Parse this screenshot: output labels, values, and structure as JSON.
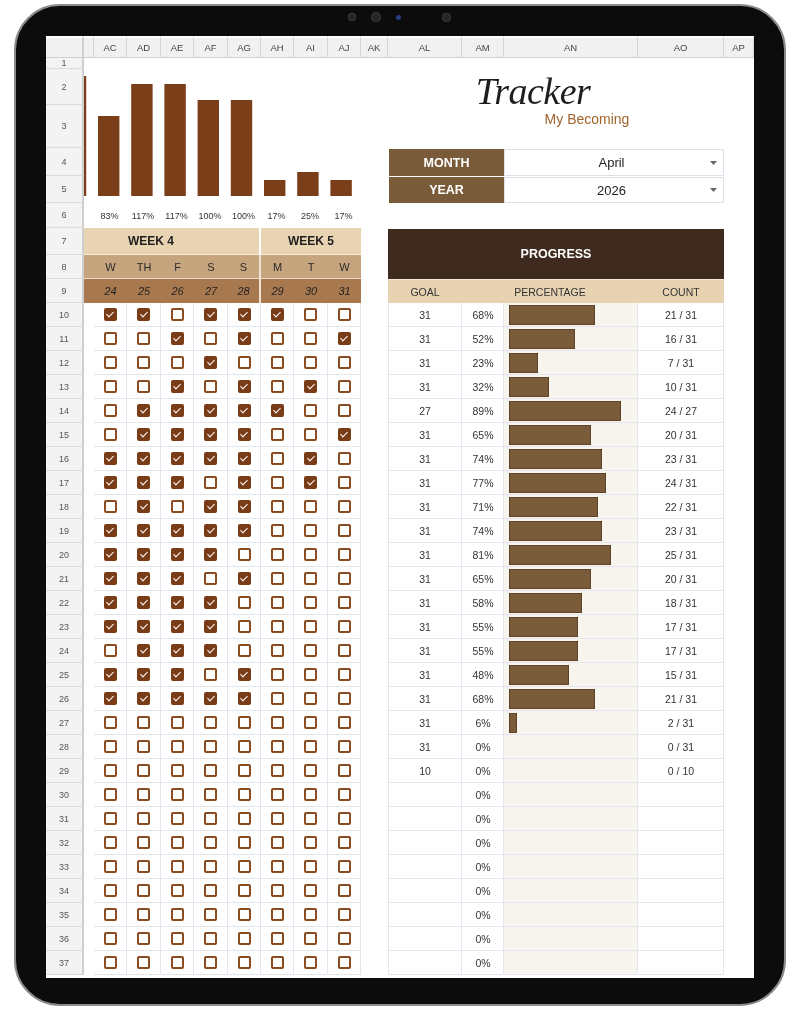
{
  "sheet": {
    "column_headers": [
      "AC",
      "AD",
      "AE",
      "AF",
      "AG",
      "AH",
      "AI",
      "AJ",
      "AK",
      "AL",
      "AM",
      "AN",
      "AO",
      "AP"
    ],
    "row_numbers": [
      "1",
      "2",
      "3",
      "4",
      "5",
      "6",
      "7",
      "8",
      "9",
      "10",
      "11",
      "12",
      "13",
      "14",
      "15",
      "16",
      "17",
      "18",
      "19",
      "20",
      "21",
      "22",
      "23",
      "24",
      "25",
      "26",
      "27",
      "28",
      "29",
      "30",
      "31",
      "32",
      "33",
      "34",
      "35",
      "36",
      "37"
    ]
  },
  "daily_percentages": [
    "83%",
    "117%",
    "117%",
    "100%",
    "100%",
    "17%",
    "25%",
    "17%"
  ],
  "logo": {
    "title": "Tracker",
    "subtitle": "My Becoming"
  },
  "selectors": [
    {
      "label": "MONTH",
      "value": "April"
    },
    {
      "label": "YEAR",
      "value": "2026"
    }
  ],
  "weeks": [
    {
      "label": "WEEK 4",
      "days": [
        {
          "day": "W",
          "date": "24"
        },
        {
          "day": "TH",
          "date": "25"
        },
        {
          "day": "F",
          "date": "26"
        },
        {
          "day": "S",
          "date": "27"
        },
        {
          "day": "S",
          "date": "28"
        }
      ]
    },
    {
      "label": "WEEK 5",
      "days": [
        {
          "day": "M",
          "date": "29"
        },
        {
          "day": "T",
          "date": "30"
        },
        {
          "day": "W",
          "date": "31"
        }
      ]
    }
  ],
  "habits": [
    {
      "checks": [
        {
          "checked": true
        },
        {
          "checked": true
        },
        {
          "checked": false
        },
        {
          "checked": true
        },
        {
          "checked": true
        },
        {
          "checked": true
        },
        {
          "checked": false
        },
        {
          "checked": false
        }
      ]
    },
    {
      "checks": [
        {
          "checked": false
        },
        {
          "checked": false
        },
        {
          "checked": true
        },
        {
          "checked": false
        },
        {
          "checked": true
        },
        {
          "checked": false
        },
        {
          "checked": false
        },
        {
          "checked": true
        }
      ]
    },
    {
      "checks": [
        {
          "checked": false
        },
        {
          "checked": false
        },
        {
          "checked": false
        },
        {
          "checked": true
        },
        {
          "checked": false
        },
        {
          "checked": false
        },
        {
          "checked": false
        },
        {
          "checked": false
        }
      ]
    },
    {
      "checks": [
        {
          "checked": false
        },
        {
          "checked": false
        },
        {
          "checked": true
        },
        {
          "checked": false
        },
        {
          "checked": true
        },
        {
          "checked": false
        },
        {
          "checked": true
        },
        {
          "checked": false
        }
      ]
    },
    {
      "checks": [
        {
          "checked": false
        },
        {
          "checked": true
        },
        {
          "checked": true
        },
        {
          "checked": true
        },
        {
          "checked": true
        },
        {
          "checked": true
        },
        {
          "checked": false
        },
        {
          "checked": false
        }
      ]
    },
    {
      "checks": [
        {
          "checked": false
        },
        {
          "checked": true
        },
        {
          "checked": true
        },
        {
          "checked": true
        },
        {
          "checked": true
        },
        {
          "checked": false
        },
        {
          "checked": false
        },
        {
          "checked": true
        }
      ]
    },
    {
      "checks": [
        {
          "checked": true
        },
        {
          "checked": true
        },
        {
          "checked": true
        },
        {
          "checked": true
        },
        {
          "checked": true
        },
        {
          "checked": false
        },
        {
          "checked": true
        },
        {
          "checked": false
        }
      ]
    },
    {
      "checks": [
        {
          "checked": true
        },
        {
          "checked": true
        },
        {
          "checked": true
        },
        {
          "checked": false
        },
        {
          "checked": true
        },
        {
          "checked": false
        },
        {
          "checked": true
        },
        {
          "checked": false
        }
      ]
    },
    {
      "checks": [
        {
          "checked": false
        },
        {
          "checked": true
        },
        {
          "checked": false
        },
        {
          "checked": true
        },
        {
          "checked": true
        },
        {
          "checked": false
        },
        {
          "checked": false
        },
        {
          "checked": false
        }
      ]
    },
    {
      "checks": [
        {
          "checked": true
        },
        {
          "checked": true
        },
        {
          "checked": true
        },
        {
          "checked": true
        },
        {
          "checked": true
        },
        {
          "checked": false
        },
        {
          "checked": false
        },
        {
          "checked": false
        }
      ]
    },
    {
      "checks": [
        {
          "checked": true
        },
        {
          "checked": true
        },
        {
          "checked": true
        },
        {
          "checked": true
        },
        {
          "checked": false
        },
        {
          "checked": false
        },
        {
          "checked": false
        },
        {
          "checked": false
        }
      ]
    },
    {
      "checks": [
        {
          "checked": true
        },
        {
          "checked": true
        },
        {
          "checked": true
        },
        {
          "checked": false
        },
        {
          "checked": true
        },
        {
          "checked": false
        },
        {
          "checked": false
        },
        {
          "checked": false
        }
      ]
    },
    {
      "checks": [
        {
          "checked": true
        },
        {
          "checked": true
        },
        {
          "checked": true
        },
        {
          "checked": true
        },
        {
          "checked": false
        },
        {
          "checked": false
        },
        {
          "checked": false
        },
        {
          "checked": false
        }
      ]
    },
    {
      "checks": [
        {
          "checked": true
        },
        {
          "checked": true
        },
        {
          "checked": true
        },
        {
          "checked": true
        },
        {
          "checked": false
        },
        {
          "checked": false
        },
        {
          "checked": false
        },
        {
          "checked": false
        }
      ]
    },
    {
      "checks": [
        {
          "checked": false
        },
        {
          "checked": true
        },
        {
          "checked": true
        },
        {
          "checked": true
        },
        {
          "checked": false
        },
        {
          "checked": false
        },
        {
          "checked": false
        },
        {
          "checked": false
        }
      ]
    },
    {
      "checks": [
        {
          "checked": true
        },
        {
          "checked": true
        },
        {
          "checked": true
        },
        {
          "checked": false
        },
        {
          "checked": true
        },
        {
          "checked": false
        },
        {
          "checked": false
        },
        {
          "checked": false
        }
      ]
    },
    {
      "checks": [
        {
          "checked": true
        },
        {
          "checked": true
        },
        {
          "checked": true
        },
        {
          "checked": true
        },
        {
          "checked": true
        },
        {
          "checked": false
        },
        {
          "checked": false
        },
        {
          "checked": false
        }
      ]
    },
    {
      "checks": [
        {
          "checked": false
        },
        {
          "checked": false
        },
        {
          "checked": false
        },
        {
          "checked": false
        },
        {
          "checked": false
        },
        {
          "checked": false
        },
        {
          "checked": false
        },
        {
          "checked": false
        }
      ]
    },
    {
      "checks": [
        {
          "checked": false
        },
        {
          "checked": false
        },
        {
          "checked": false
        },
        {
          "checked": false
        },
        {
          "checked": false
        },
        {
          "checked": false
        },
        {
          "checked": false
        },
        {
          "checked": false
        }
      ]
    },
    {
      "checks": [
        {
          "checked": false
        },
        {
          "checked": false
        },
        {
          "checked": false
        },
        {
          "checked": false
        },
        {
          "checked": false
        },
        {
          "checked": false
        },
        {
          "checked": false
        },
        {
          "checked": false
        }
      ]
    },
    {
      "checks": [
        {
          "checked": false
        },
        {
          "checked": false
        },
        {
          "checked": false
        },
        {
          "checked": false
        },
        {
          "checked": false
        },
        {
          "checked": false
        },
        {
          "checked": false
        },
        {
          "checked": false
        }
      ]
    },
    {
      "checks": [
        {
          "checked": false
        },
        {
          "checked": false
        },
        {
          "checked": false
        },
        {
          "checked": false
        },
        {
          "checked": false
        },
        {
          "checked": false
        },
        {
          "checked": false
        },
        {
          "checked": false
        }
      ]
    },
    {
      "checks": [
        {
          "checked": false
        },
        {
          "checked": false
        },
        {
          "checked": false
        },
        {
          "checked": false
        },
        {
          "checked": false
        },
        {
          "checked": false
        },
        {
          "checked": false
        },
        {
          "checked": false
        }
      ]
    },
    {
      "checks": [
        {
          "checked": false
        },
        {
          "checked": false
        },
        {
          "checked": false
        },
        {
          "checked": false
        },
        {
          "checked": false
        },
        {
          "checked": false
        },
        {
          "checked": false
        },
        {
          "checked": false
        }
      ]
    },
    {
      "checks": [
        {
          "checked": false
        },
        {
          "checked": false
        },
        {
          "checked": false
        },
        {
          "checked": false
        },
        {
          "checked": false
        },
        {
          "checked": false
        },
        {
          "checked": false
        },
        {
          "checked": false
        }
      ]
    },
    {
      "checks": [
        {
          "checked": false
        },
        {
          "checked": false
        },
        {
          "checked": false
        },
        {
          "checked": false
        },
        {
          "checked": false
        },
        {
          "checked": false
        },
        {
          "checked": false
        },
        {
          "checked": false
        }
      ]
    },
    {
      "checks": [
        {
          "checked": false
        },
        {
          "checked": false
        },
        {
          "checked": false
        },
        {
          "checked": false
        },
        {
          "checked": false
        },
        {
          "checked": false
        },
        {
          "checked": false
        },
        {
          "checked": false
        }
      ]
    },
    {
      "checks": [
        {
          "checked": false
        },
        {
          "checked": false
        },
        {
          "checked": false
        },
        {
          "checked": false
        },
        {
          "checked": false
        },
        {
          "checked": false
        },
        {
          "checked": false
        },
        {
          "checked": false
        }
      ]
    }
  ],
  "progress": {
    "title": "PROGRESS",
    "columns": [
      "GOAL",
      "PERCENTAGE",
      "COUNT"
    ],
    "rows": [
      {
        "goal": "31",
        "percentage": "68%",
        "level": 0.68,
        "count": "21 / 31"
      },
      {
        "goal": "31",
        "percentage": "52%",
        "level": 0.52,
        "count": "16 / 31"
      },
      {
        "goal": "31",
        "percentage": "23%",
        "level": 0.23,
        "count": "7 / 31"
      },
      {
        "goal": "31",
        "percentage": "32%",
        "level": 0.32,
        "count": "10 / 31"
      },
      {
        "goal": "27",
        "percentage": "89%",
        "level": 0.89,
        "count": "24 / 27"
      },
      {
        "goal": "31",
        "percentage": "65%",
        "level": 0.65,
        "count": "20 / 31"
      },
      {
        "goal": "31",
        "percentage": "74%",
        "level": 0.74,
        "count": "23 / 31"
      },
      {
        "goal": "31",
        "percentage": "77%",
        "level": 0.77,
        "count": "24 / 31"
      },
      {
        "goal": "31",
        "percentage": "71%",
        "level": 0.71,
        "count": "22 / 31"
      },
      {
        "goal": "31",
        "percentage": "74%",
        "level": 0.74,
        "count": "23 / 31"
      },
      {
        "goal": "31",
        "percentage": "81%",
        "level": 0.81,
        "count": "25 / 31"
      },
      {
        "goal": "31",
        "percentage": "65%",
        "level": 0.65,
        "count": "20 / 31"
      },
      {
        "goal": "31",
        "percentage": "58%",
        "level": 0.58,
        "count": "18 / 31"
      },
      {
        "goal": "31",
        "percentage": "55%",
        "level": 0.55,
        "count": "17 / 31"
      },
      {
        "goal": "31",
        "percentage": "55%",
        "level": 0.55,
        "count": "17 / 31"
      },
      {
        "goal": "31",
        "percentage": "48%",
        "level": 0.48,
        "count": "15 / 31"
      },
      {
        "goal": "31",
        "percentage": "68%",
        "level": 0.68,
        "count": "21 / 31"
      },
      {
        "goal": "31",
        "percentage": "6%",
        "level": 0.06,
        "count": "2 / 31"
      },
      {
        "goal": "31",
        "percentage": "0%",
        "count": "0 / 31"
      },
      {
        "goal": "10",
        "percentage": "0%",
        "count": "0 / 10"
      },
      {
        "percentage": "0%"
      },
      {
        "percentage": "0%"
      },
      {
        "percentage": "0%"
      },
      {
        "percentage": "0%"
      },
      {
        "percentage": "0%"
      },
      {
        "percentage": "0%"
      },
      {
        "percentage": "0%"
      },
      {
        "percentage": "0%"
      }
    ]
  }
}
